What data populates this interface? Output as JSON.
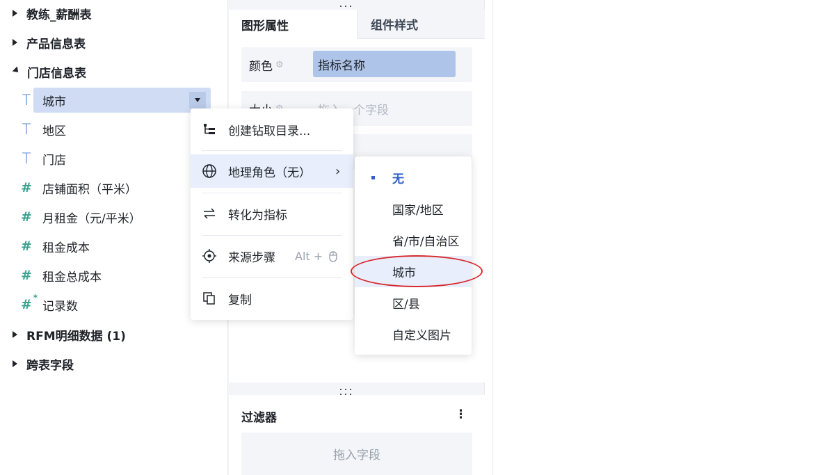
{
  "tree": {
    "groups": [
      {
        "label": "教练_薪酬表",
        "expanded": false
      },
      {
        "label": "产品信息表",
        "expanded": false
      },
      {
        "label": "门店信息表",
        "expanded": true
      },
      {
        "label": "RFM明细数据 (1)",
        "expanded": false
      },
      {
        "label": "跨表字段",
        "expanded": false
      }
    ],
    "fields": [
      {
        "icon": "T",
        "icon_name": "text-field-icon",
        "label": "城市"
      },
      {
        "icon": "T",
        "icon_name": "text-field-icon",
        "label": "地区"
      },
      {
        "icon": "T",
        "icon_name": "text-field-icon",
        "label": "门店"
      },
      {
        "icon": "#",
        "icon_name": "number-field-icon",
        "label": "店铺面积（平米）"
      },
      {
        "icon": "#",
        "icon_name": "number-field-icon",
        "label": "月租金（元/平米）"
      },
      {
        "icon": "#",
        "icon_name": "number-field-icon",
        "label": "租金成本"
      },
      {
        "icon": "#",
        "icon_name": "number-field-icon",
        "label": "租金总成本"
      },
      {
        "icon": "#",
        "icon_name": "calculated-number-field-icon",
        "label": "记录数"
      }
    ]
  },
  "panel": {
    "tabs": {
      "active": "图形属性",
      "inactive": "组件样式"
    },
    "color": {
      "label": "颜色",
      "value": "指标名称"
    },
    "size": {
      "label": "大小",
      "placeholder": "拖入一个字段"
    },
    "third": {
      "placeholder": "段"
    },
    "filter": {
      "title": "过滤器",
      "placeholder": "拖入字段"
    }
  },
  "context_menu": {
    "items": [
      {
        "label": "创建钻取目录..."
      },
      {
        "label": "地理角色（无）"
      },
      {
        "label": "转化为指标"
      },
      {
        "label": "来源步骤",
        "shortcut": "Alt +"
      },
      {
        "label": "复制"
      }
    ]
  },
  "submenu": {
    "items": [
      {
        "label": "无",
        "selected": true
      },
      {
        "label": "国家/地区"
      },
      {
        "label": "省/市/自治区"
      },
      {
        "label": "城市",
        "highlighted": true
      },
      {
        "label": "区/县"
      },
      {
        "label": "自定义图片"
      }
    ]
  },
  "colors": {
    "accent": "#2f5fc9",
    "selection": "#cfdcf4",
    "annotation": "#d8282c"
  }
}
